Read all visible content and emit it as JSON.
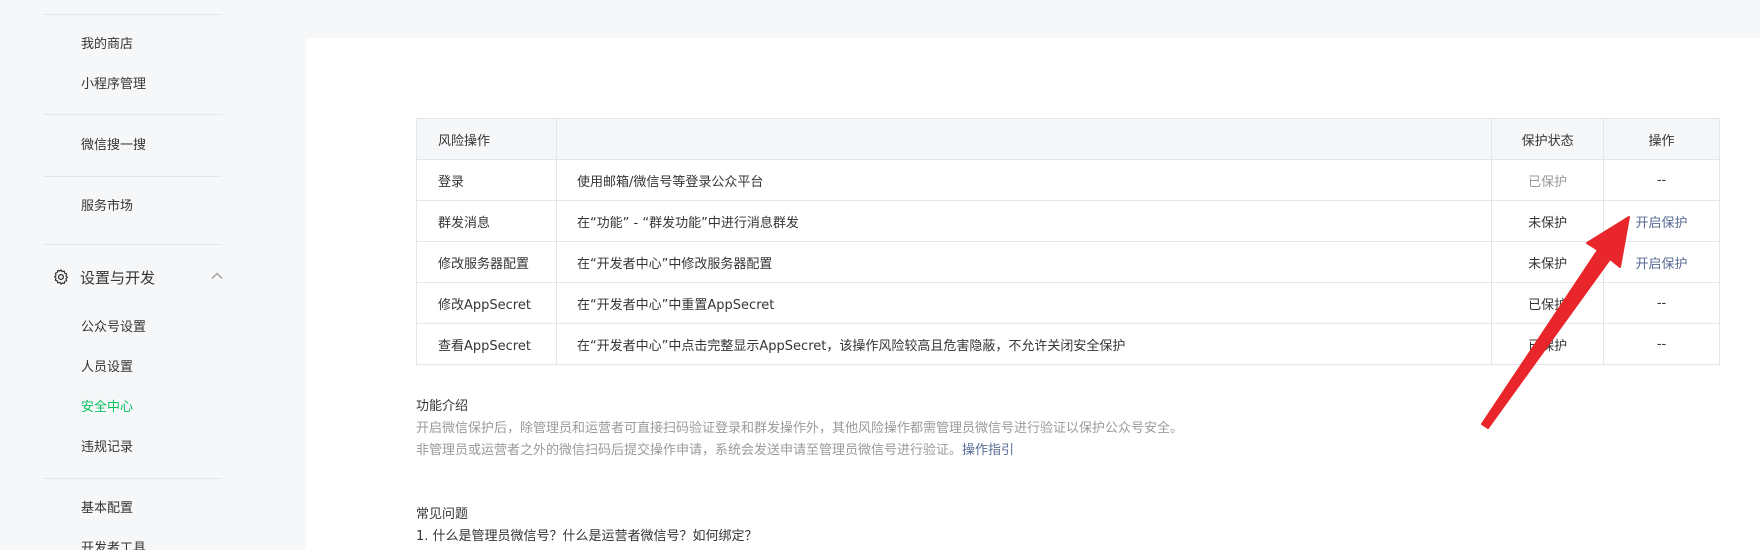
{
  "sidebar": {
    "items_top": [
      "我的商店",
      "小程序管理",
      "微信搜一搜",
      "服务市场"
    ],
    "group_label": "设置与开发",
    "group_items": [
      "公众号设置",
      "人员设置",
      "安全中心",
      "违规记录"
    ],
    "items_bottom": [
      "基本配置",
      "开发者工具"
    ],
    "active_item": "安全中心",
    "icons": {
      "group": "gear-icon",
      "collapse": "chevron-up-icon"
    }
  },
  "table": {
    "headers": {
      "risk": "风险操作",
      "desc": "",
      "status": "保护状态",
      "op": "操作"
    },
    "rows": [
      {
        "risk": "登录",
        "desc": "使用邮箱/微信号等登录公众平台",
        "status": "已保护",
        "op": "--"
      },
      {
        "risk": "群发消息",
        "desc": "在“功能” - “群发功能”中进行消息群发",
        "status": "未保护",
        "op": "开启保护"
      },
      {
        "risk": "修改服务器配置",
        "desc": "在“开发者中心”中修改服务器配置",
        "status": "未保护",
        "op": "开启保护"
      },
      {
        "risk": "修改AppSecret",
        "desc": "在“开发者中心”中重置AppSecret",
        "status": "已保护",
        "op": "--"
      },
      {
        "risk": "查看AppSecret",
        "desc": "在“开发者中心”中点击完整显示AppSecret，该操作风险较高且危害隐蔽，不允许关闭安全保护",
        "status": "已保护",
        "op": "--"
      }
    ]
  },
  "intro": {
    "title": "功能介绍",
    "line1": "开启微信保护后，除管理员和运营者可直接扫码验证登录和群发操作外，其他风险操作都需管理员微信号进行验证以保护公众号安全。",
    "line2": "非管理员或运营者之外的微信扫码后提交操作申请，系统会发送申请至管理员微信号进行验证。",
    "guide_link": "操作指引"
  },
  "faq": {
    "title": "常见问题",
    "items": [
      "1. 什么是管理员微信号？什么是运营者微信号？如何绑定？"
    ]
  },
  "colors": {
    "accent_green": "#07c160",
    "link_blue": "#576b95",
    "arrow_red": "#e8262b"
  }
}
